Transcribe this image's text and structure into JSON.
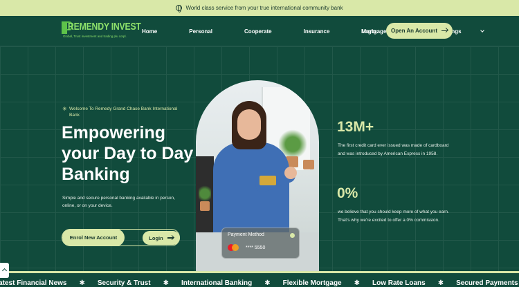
{
  "announcement": {
    "icon": "globe-icon",
    "text": "World class service from your true international community bank"
  },
  "brand": {
    "name": "REMENDY INVEST",
    "tagline": "Global, Trust investment and trading plu corpl."
  },
  "nav": {
    "items": [
      {
        "label": "Home"
      },
      {
        "label": "Personal"
      },
      {
        "label": "Cooperate"
      },
      {
        "label": "Insurance"
      },
      {
        "label": "Mortgages"
      },
      {
        "label": "Sefton Savings",
        "has_dropdown": true
      }
    ],
    "login_label": "Login",
    "cta_label": "Open An Account"
  },
  "hero": {
    "welcome": "Welcome To Remedy Grand Chase Bank International Bank",
    "title": "Empowering your Day to Day Banking",
    "subtitle": "Simple and secure personal banking available in person, online, or on your device.",
    "enrol_label": "Enrol New Account",
    "login_label": "Login"
  },
  "payment_card": {
    "title": "Payment Method",
    "card_number": "**** 5550"
  },
  "stats": [
    {
      "value": "13M+",
      "text": "The first credit card ever issued was made of cardboard and was introduced by American Express in 1958."
    },
    {
      "value": "0%",
      "text": "we believe that you should keep more of what you earn. That's why we're excited to offer a 0% commission."
    }
  ],
  "ticker": [
    "Latest Financial News",
    "Security & Trust",
    "International Banking",
    "Flexible Mortgage",
    "Low Rate Loans",
    "Secured Payments"
  ],
  "colors": {
    "primary": "#114b3c",
    "accent": "#d9e8a8",
    "brand_green": "#8de06a"
  }
}
